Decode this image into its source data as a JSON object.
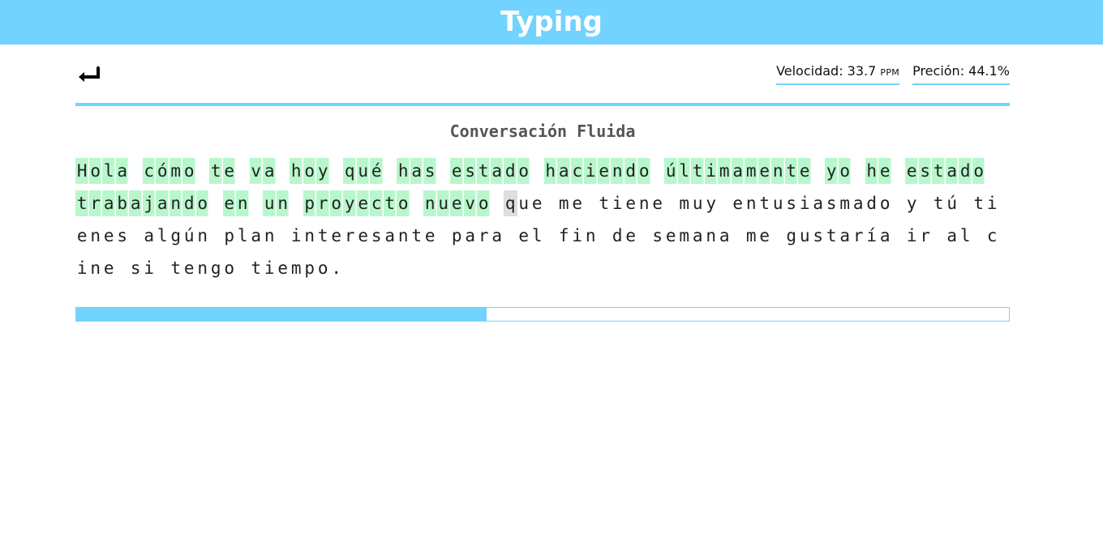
{
  "app": {
    "title": "Typing"
  },
  "toolbar": {
    "back_icon": "return-arrow-icon"
  },
  "stats": {
    "speed_label": "Velocidad: 33.7",
    "speed_unit": "PPM",
    "accuracy_label": "Preción: 44.1%"
  },
  "lesson": {
    "title": "Conversación Fluida",
    "lines": [
      "Hola cómo te va hoy qué has estado haciendo últimamente yo he estado ",
      "trabajando en un proyecto nuevo que me tiene muy entusiasmado y tú ti",
      "enes algún plan interesante para el fin de semana me gustaría ir al c",
      "ine si tengo tiempo."
    ],
    "typed_chars": 101,
    "cursor_index": 101
  },
  "progress": {
    "fraction": 0.44
  },
  "colors": {
    "accent": "#72d3fe",
    "typed_highlight": "#b8f7cc",
    "cursor_highlight": "#dedede"
  }
}
